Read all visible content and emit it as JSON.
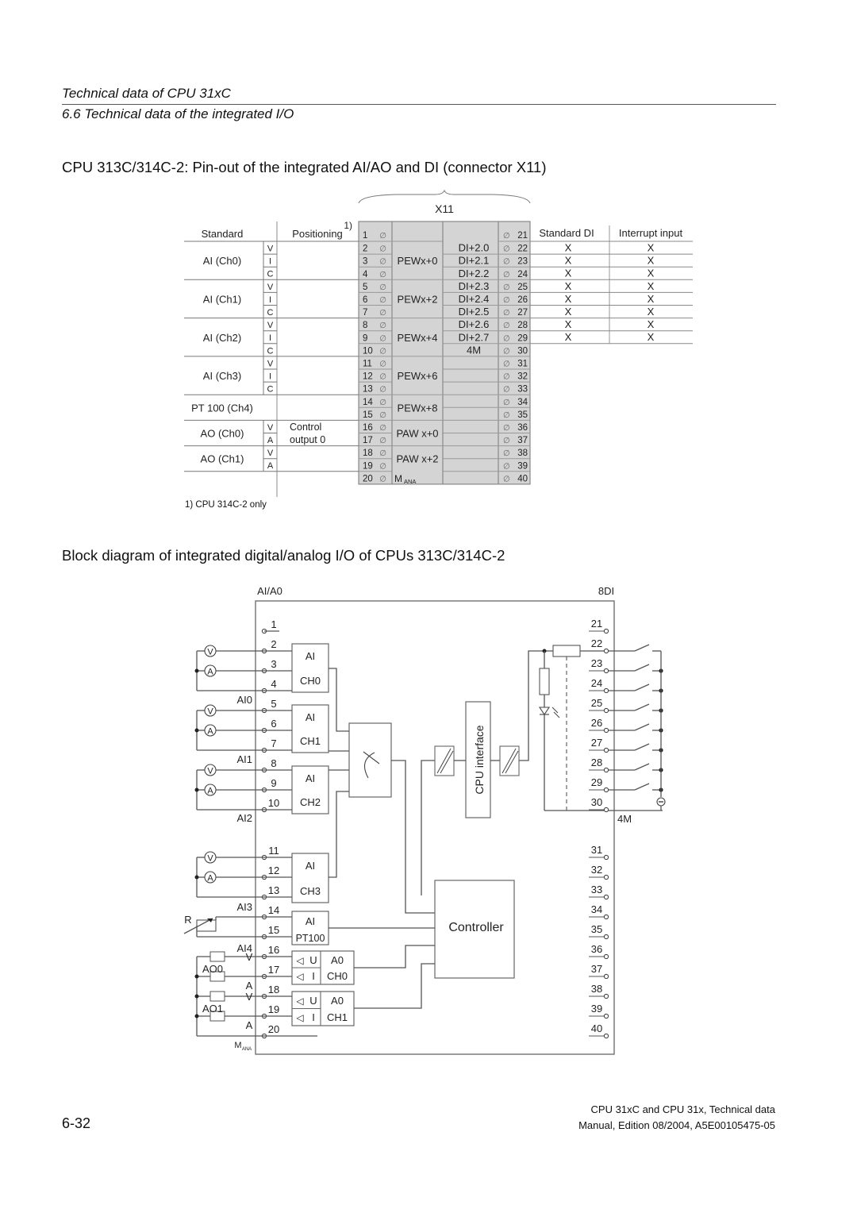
{
  "header": {
    "chapter": "Technical data of CPU 31xC",
    "section": "6.6 Technical data of the integrated I/O"
  },
  "pinout": {
    "title": "CPU 313C/314C-2: Pin-out of the integrated AI/AO and DI (connector X11)",
    "connector_label": "X11",
    "col_standard": "Standard",
    "col_positioning": "Positioning",
    "positioning_footnote_mark": "1)",
    "col_standard_di": "Standard DI",
    "col_interrupt": "Interrupt input",
    "left_groups": [
      {
        "name": "AI (Ch0)",
        "sub": [
          "V",
          "I",
          "C"
        ],
        "address": "PEWx+0",
        "pins": [
          2,
          3,
          4
        ]
      },
      {
        "name": "AI (Ch1)",
        "sub": [
          "V",
          "I",
          "C"
        ],
        "address": "PEWx+2",
        "pins": [
          5,
          6,
          7
        ]
      },
      {
        "name": "AI (Ch2)",
        "sub": [
          "V",
          "I",
          "C"
        ],
        "address": "PEWx+4",
        "pins": [
          8,
          9,
          10
        ]
      },
      {
        "name": "AI (Ch3)",
        "sub": [
          "V",
          "I",
          "C"
        ],
        "address": "PEWx+6",
        "pins": [
          11,
          12,
          13
        ]
      },
      {
        "name": "PT 100 (Ch4)",
        "sub": [],
        "address": "PEWx+8",
        "pins": [
          14,
          15
        ]
      },
      {
        "name": "AO (Ch0)",
        "sub": [
          "V",
          "A"
        ],
        "positioning": [
          "Control",
          "output 0"
        ],
        "address": "PAW x+0",
        "pins": [
          16,
          17
        ]
      },
      {
        "name": "AO (Ch1)",
        "sub": [
          "V",
          "A"
        ],
        "address": "PAW x+2",
        "pins": [
          18,
          19
        ]
      }
    ],
    "pin20_label": "M",
    "pin20_sub": "ANA",
    "right_rows": [
      {
        "pin": 21,
        "addr": "",
        "std": "",
        "int": ""
      },
      {
        "pin": 22,
        "addr": "DI+2.0",
        "std": "X",
        "int": "X"
      },
      {
        "pin": 23,
        "addr": "DI+2.1",
        "std": "X",
        "int": "X"
      },
      {
        "pin": 24,
        "addr": "DI+2.2",
        "std": "X",
        "int": "X"
      },
      {
        "pin": 25,
        "addr": "DI+2.3",
        "std": "X",
        "int": "X"
      },
      {
        "pin": 26,
        "addr": "DI+2.4",
        "std": "X",
        "int": "X"
      },
      {
        "pin": 27,
        "addr": "DI+2.5",
        "std": "X",
        "int": "X"
      },
      {
        "pin": 28,
        "addr": "DI+2.6",
        "std": "X",
        "int": "X"
      },
      {
        "pin": 29,
        "addr": "DI+2.7",
        "std": "X",
        "int": "X"
      },
      {
        "pin": 30,
        "addr": "4M",
        "std": "",
        "int": ""
      },
      {
        "pin": 31,
        "addr": ""
      },
      {
        "pin": 32,
        "addr": ""
      },
      {
        "pin": 33,
        "addr": ""
      },
      {
        "pin": 34,
        "addr": ""
      },
      {
        "pin": 35,
        "addr": ""
      },
      {
        "pin": 36,
        "addr": ""
      },
      {
        "pin": 37,
        "addr": ""
      },
      {
        "pin": 38,
        "addr": ""
      },
      {
        "pin": 39,
        "addr": ""
      },
      {
        "pin": 40,
        "addr": ""
      }
    ],
    "footnote": "1) CPU 314C-2 only"
  },
  "block": {
    "title": "Block diagram of integrated digital/analog I/O of CPUs 313C/314C-2",
    "label_left": "AI/A0",
    "label_right": "8DI",
    "ai_blocks": [
      {
        "top": "AI",
        "bottom": "CH0",
        "group": "AI0"
      },
      {
        "top": "AI",
        "bottom": "CH1",
        "group": "AI1"
      },
      {
        "top": "AI",
        "bottom": "CH2",
        "group": "AI2"
      },
      {
        "top": "AI",
        "bottom": "CH3",
        "group": "AI3"
      },
      {
        "top": "AI",
        "bottom": "PT100",
        "group": "AI4"
      }
    ],
    "ao_blocks": [
      {
        "u": "U",
        "i": "I",
        "top": "A0",
        "bottom": "CH0",
        "group": "AO0"
      },
      {
        "u": "U",
        "i": "I",
        "top": "A0",
        "bottom": "CH1",
        "group": "AO1"
      }
    ],
    "meter_v": "V",
    "meter_a": "A",
    "ao_v": "V",
    "ao_a": "A",
    "resistor_label": "R",
    "mana": "M",
    "mana_sub": "ANA",
    "cpu_interface": "CPU interface",
    "controller": "Controller",
    "m4": "4M",
    "left_pins": [
      1,
      2,
      3,
      4,
      5,
      6,
      7,
      8,
      9,
      10,
      11,
      12,
      13,
      14,
      15,
      16,
      17,
      18,
      19,
      20
    ],
    "right_pins": [
      21,
      22,
      23,
      24,
      25,
      26,
      27,
      28,
      29,
      30,
      31,
      32,
      33,
      34,
      35,
      36,
      37,
      38,
      39,
      40
    ]
  },
  "footer": {
    "page": "6-32",
    "line1": "CPU 31xC and CPU 31x, Technical data",
    "line2": "Manual, Edition 08/2004, A5E00105475-05"
  }
}
